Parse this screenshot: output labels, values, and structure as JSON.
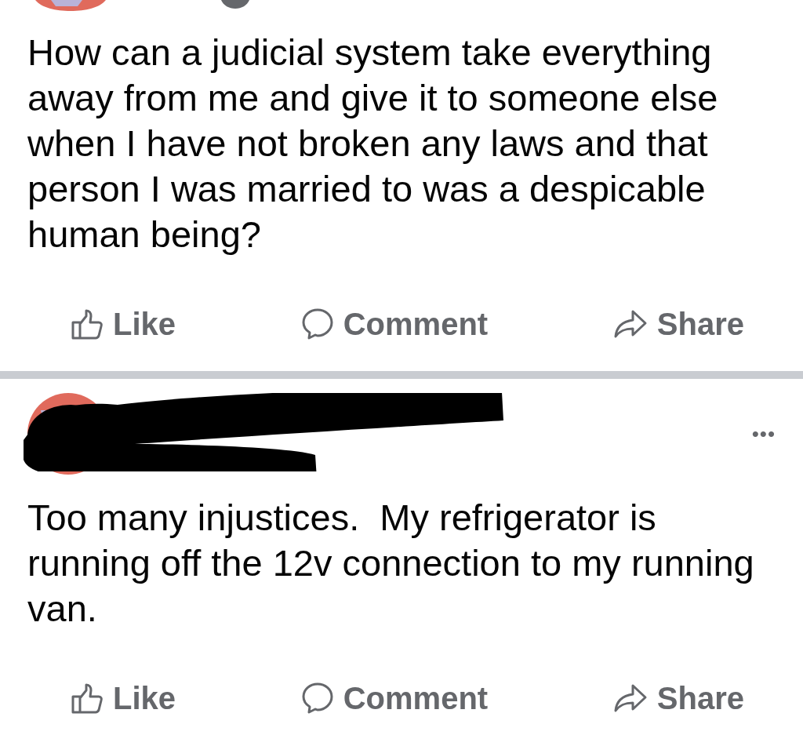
{
  "posts": [
    {
      "kind": "cut",
      "text": "How can a judicial system take everything away from me and give it to someone else when I have not broken any laws and that person I was married to was a despicable human being?",
      "actions": [
        {
          "kind": "like",
          "label": "Like"
        },
        {
          "kind": "comment",
          "label": "Comment"
        },
        {
          "kind": "share",
          "label": "Share"
        }
      ]
    },
    {
      "kind": "redacted",
      "more": "•••",
      "text": "Too many injustices.  My refrigerator is running off the 12v connection to my running van.",
      "actions": [
        {
          "kind": "like",
          "label": "Like"
        },
        {
          "kind": "comment",
          "label": "Comment"
        },
        {
          "kind": "share",
          "label": "Share"
        }
      ]
    }
  ]
}
